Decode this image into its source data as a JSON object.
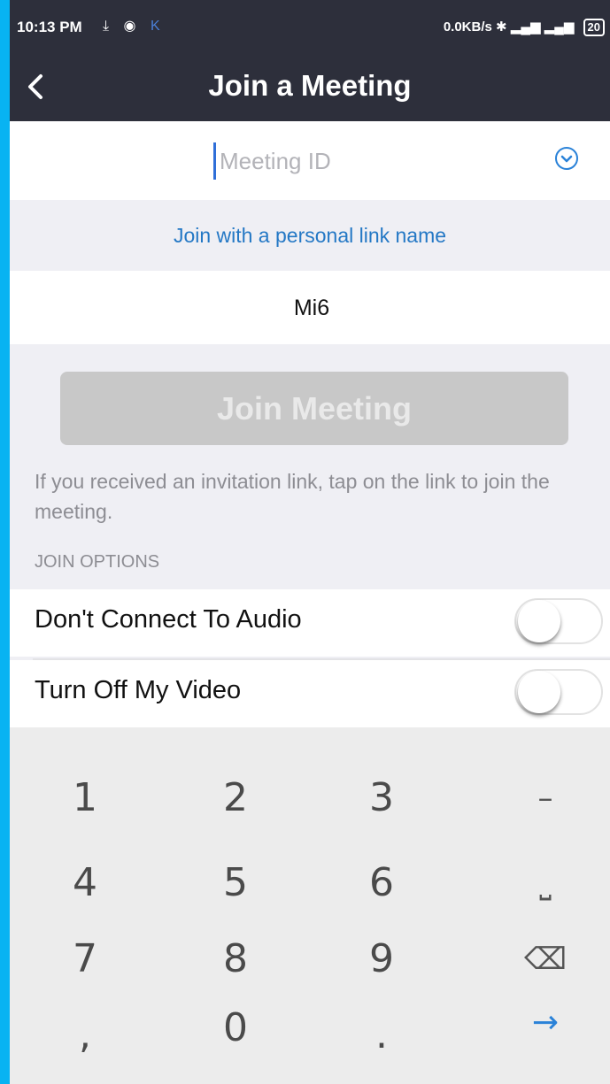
{
  "status_bar": {
    "time": "10:13 PM",
    "icons_left": [
      "download-icon",
      "chrome-icon",
      "app-icon"
    ],
    "network_speed": "0.0KB/s",
    "battery": "20"
  },
  "nav": {
    "back_icon": "chevron-left-icon",
    "title": "Join a Meeting"
  },
  "meeting_id": {
    "placeholder": "Meeting ID",
    "value": ""
  },
  "personal_link_label": "Join with a personal link name",
  "name_field": {
    "value": "Mi6"
  },
  "join_button_label": "Join Meeting",
  "hint_text": "If you received an invitation link, tap on the link to join the meeting.",
  "options_header": "JOIN OPTIONS",
  "options": [
    {
      "label": "Don't Connect To Audio",
      "enabled": false
    },
    {
      "label": "Turn Off My Video",
      "enabled": false
    }
  ],
  "keypad": {
    "row1": [
      "1",
      "2",
      "3",
      "–"
    ],
    "row2": [
      "4",
      "5",
      "6",
      "⎵"
    ],
    "row3": [
      "7",
      "8",
      "9",
      "⌫"
    ],
    "row4": [
      ",",
      "0",
      ".",
      "→"
    ]
  },
  "colors": {
    "header_bg": "#2d2f3b",
    "link_blue": "#2478c5",
    "frame_blue": "#08b3f2",
    "button_disabled": "#c8c8c8"
  }
}
